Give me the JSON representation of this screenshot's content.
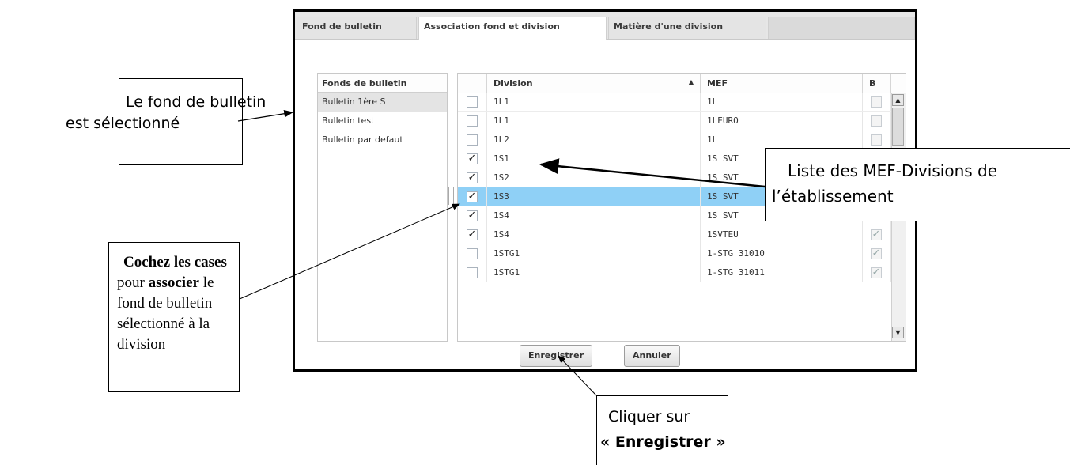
{
  "tabs": [
    {
      "label": "Fond de bulletin",
      "active": false
    },
    {
      "label": "Association fond et division",
      "active": true
    },
    {
      "label": "Matière d'une division",
      "active": false
    }
  ],
  "fonds": {
    "header": "Fonds de bulletin",
    "items": [
      "Bulletin 1ère S",
      "Bulletin test",
      "Bulletin par defaut"
    ],
    "selected_index": 0
  },
  "grid": {
    "headers": {
      "division": "Division",
      "sort_icon": "▲",
      "mef": "MEF",
      "b": "B"
    },
    "rows": [
      {
        "checked": false,
        "division": "1L1",
        "mef": "1L",
        "b": false
      },
      {
        "checked": false,
        "division": "1L1",
        "mef": "1LEURO",
        "b": false
      },
      {
        "checked": false,
        "division": "1L2",
        "mef": "1L",
        "b": false
      },
      {
        "checked": true,
        "division": "1S1",
        "mef": "1S SVT",
        "b": true
      },
      {
        "checked": true,
        "division": "1S2",
        "mef": "1S SVT",
        "b": true
      },
      {
        "checked": true,
        "division": "1S3",
        "mef": "1S SVT",
        "b": true
      },
      {
        "checked": true,
        "division": "1S4",
        "mef": "1S SVT",
        "b": true
      },
      {
        "checked": true,
        "division": "1S4",
        "mef": "1SVTEU",
        "b": true
      },
      {
        "checked": false,
        "division": "1STG1",
        "mef": "1-STG 31010",
        "b": true
      },
      {
        "checked": false,
        "division": "1STG1",
        "mef": "1-STG 31011",
        "b": true
      }
    ],
    "selected_row": 5
  },
  "buttons": {
    "save": "Enregistrer",
    "cancel": "Annuler"
  },
  "callouts": {
    "fond": {
      "line1": "Le fond de bulletin",
      "line2": "est sélectionné"
    },
    "liste": {
      "line1": "Liste des MEF-Divisions de",
      "line2": "l’établissement"
    },
    "cochez": {
      "bold1": "Cochez les cases",
      "t1": "pour",
      "bold2": "associer",
      "t2": "le",
      "line3": "fond de bulletin",
      "line4": "sélectionné à la",
      "line5": "division"
    },
    "cliquer": {
      "line1": "Cliquer sur",
      "line2": "« Enregistrer »"
    }
  },
  "colors": {
    "selected_row": "#8fd0f6",
    "selected_item": "#e4e4e4"
  }
}
